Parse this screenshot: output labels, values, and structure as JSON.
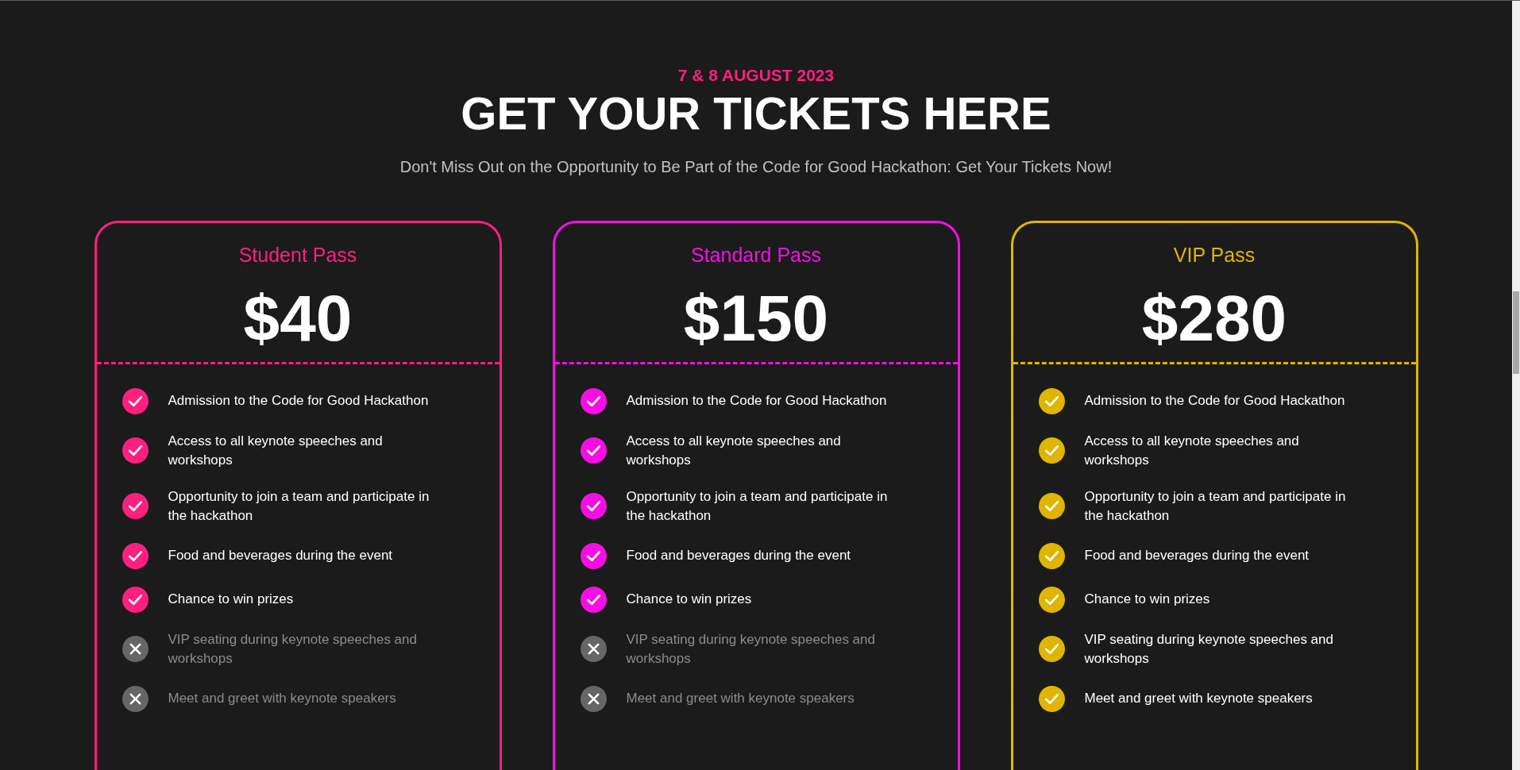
{
  "header": {
    "date": "7 & 8 AUGUST 2023",
    "title": "GET YOUR TICKETS HERE",
    "subtitle": "Don't Miss Out on the Opportunity to Be Part of the Code for Good Hackathon: Get Your Tickets Now!"
  },
  "passes": [
    {
      "name": "Student Pass",
      "price": "$40",
      "color": "#ff1f7f",
      "features": [
        {
          "text": "Admission to the Code for Good Hackathon",
          "included": true
        },
        {
          "text": "Access to all keynote speeches and workshops",
          "included": true
        },
        {
          "text": "Opportunity to join a team and participate in the hackathon",
          "included": true
        },
        {
          "text": "Food and beverages during the event",
          "included": true
        },
        {
          "text": "Chance to win prizes",
          "included": true
        },
        {
          "text": "VIP seating during keynote speeches and workshops",
          "included": false
        },
        {
          "text": "Meet and greet with keynote speakers",
          "included": false
        }
      ]
    },
    {
      "name": "Standard Pass",
      "price": "$150",
      "color": "#f60ee4",
      "features": [
        {
          "text": "Admission to the Code for Good Hackathon",
          "included": true
        },
        {
          "text": "Access to all keynote speeches and workshops",
          "included": true
        },
        {
          "text": "Opportunity to join a team and participate in the hackathon",
          "included": true
        },
        {
          "text": "Food and beverages during the event",
          "included": true
        },
        {
          "text": "Chance to win prizes",
          "included": true
        },
        {
          "text": "VIP seating during keynote speeches and workshops",
          "included": false
        },
        {
          "text": "Meet and greet with keynote speakers",
          "included": false
        }
      ]
    },
    {
      "name": "VIP Pass",
      "price": "$280",
      "color": "#e0b500",
      "features": [
        {
          "text": "Admission to the Code for Good Hackathon",
          "included": true
        },
        {
          "text": "Access to all keynote speeches and workshops",
          "included": true
        },
        {
          "text": "Opportunity to join a team and participate in the hackathon",
          "included": true
        },
        {
          "text": "Food and beverages during the event",
          "included": true
        },
        {
          "text": "Chance to win prizes",
          "included": true
        },
        {
          "text": "VIP seating during keynote speeches and workshops",
          "included": true
        },
        {
          "text": "Meet and greet with keynote speakers",
          "included": true
        }
      ]
    }
  ]
}
